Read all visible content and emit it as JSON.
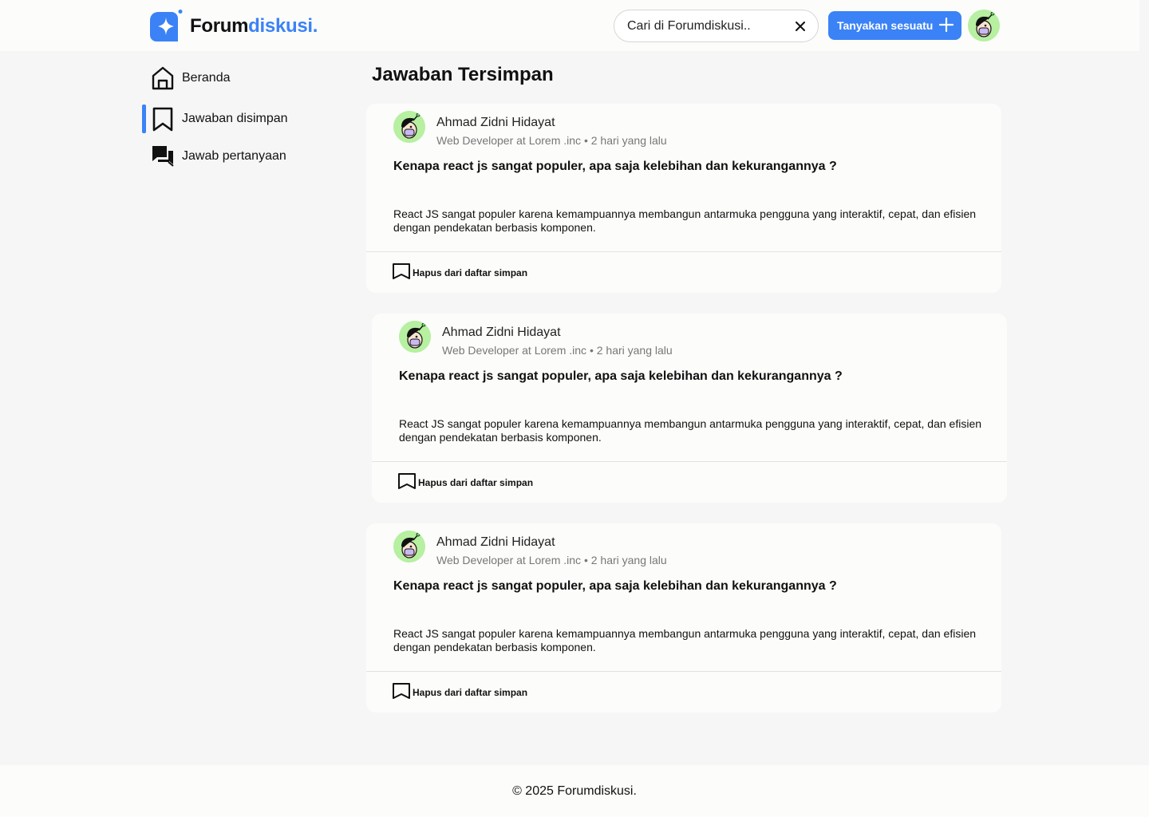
{
  "brand": {
    "name_main": "Forum",
    "name_accent": "diskusi.",
    "accent_color": "#3b82f6"
  },
  "header": {
    "search": {
      "placeholder": "Cari di Forumdiskusi..",
      "value": ""
    },
    "ask_button": {
      "label": "Tanyakan sesuatu",
      "icon": "plus-icon"
    },
    "avatar": {
      "icon": "user-avatar"
    }
  },
  "sidebar": {
    "items": [
      {
        "label": "Beranda",
        "icon": "home-icon",
        "active": false
      },
      {
        "label": "Jawaban disimpan",
        "icon": "bookmark-icon",
        "active": true
      },
      {
        "label": "Jawab pertanyaan",
        "icon": "chat-icon",
        "active": false
      }
    ]
  },
  "main": {
    "title": "Jawaban Tersimpan",
    "cards": [
      {
        "author": "Ahmad Zidni Hidayat",
        "meta": "Web Developer at Lorem .inc • 2 hari yang lalu",
        "question": "Kenapa react js sangat populer, apa saja kelebihan dan kekurangannya ?",
        "answer": "React JS sangat populer karena kemampuannya membangun antarmuka pengguna yang interaktif, cepat, dan efisien dengan pendekatan berbasis komponen.",
        "remove_label": "Hapus dari daftar simpan"
      },
      {
        "author": "Ahmad Zidni Hidayat",
        "meta": "Web Developer at Lorem .inc • 2 hari yang lalu",
        "question": "Kenapa react js sangat populer, apa saja kelebihan dan kekurangannya ?",
        "answer": "React JS sangat populer karena kemampuannya membangun antarmuka pengguna yang interaktif, cepat, dan efisien dengan pendekatan berbasis komponen.",
        "remove_label": "Hapus dari daftar simpan"
      },
      {
        "author": "Ahmad Zidni Hidayat",
        "meta": "Web Developer at Lorem .inc • 2 hari yang lalu",
        "question": "Kenapa react js sangat populer, apa saja kelebihan dan kekurangannya ?",
        "answer": "React JS sangat populer karena kemampuannya membangun antarmuka pengguna yang interaktif, cepat, dan efisien dengan pendekatan berbasis komponen.",
        "remove_label": "Hapus dari daftar simpan"
      }
    ]
  },
  "footer": {
    "text": "© 2025 Forumdiskusi."
  }
}
